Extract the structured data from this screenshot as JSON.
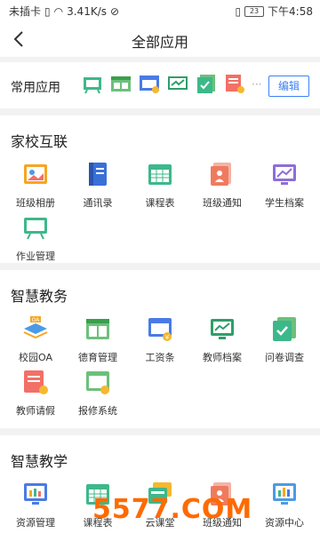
{
  "status": {
    "carrier": "未插卡",
    "speed": "3.41K/s",
    "battery": "23",
    "time": "下午4:58"
  },
  "header": {
    "title": "全部应用"
  },
  "common": {
    "label": "常用应用",
    "more": "···",
    "edit_label": "编辑"
  },
  "sections": [
    {
      "title": "家校互联",
      "apps": [
        "班级相册",
        "通讯录",
        "课程表",
        "班级通知",
        "学生档案",
        "作业管理"
      ]
    },
    {
      "title": "智慧教务",
      "apps": [
        "校园OA",
        "德育管理",
        "工资条",
        "教师档案",
        "问卷调查",
        "教师请假",
        "报修系统"
      ]
    },
    {
      "title": "智慧教学",
      "apps": [
        "资源管理",
        "课程表",
        "云课堂",
        "班级通知",
        "资源中心"
      ]
    }
  ],
  "watermark": "5577.COM",
  "colors": {
    "accent": "#3b82f6",
    "green": "#3db88a",
    "blue": "#4a7be5",
    "orange": "#ff7a45"
  }
}
